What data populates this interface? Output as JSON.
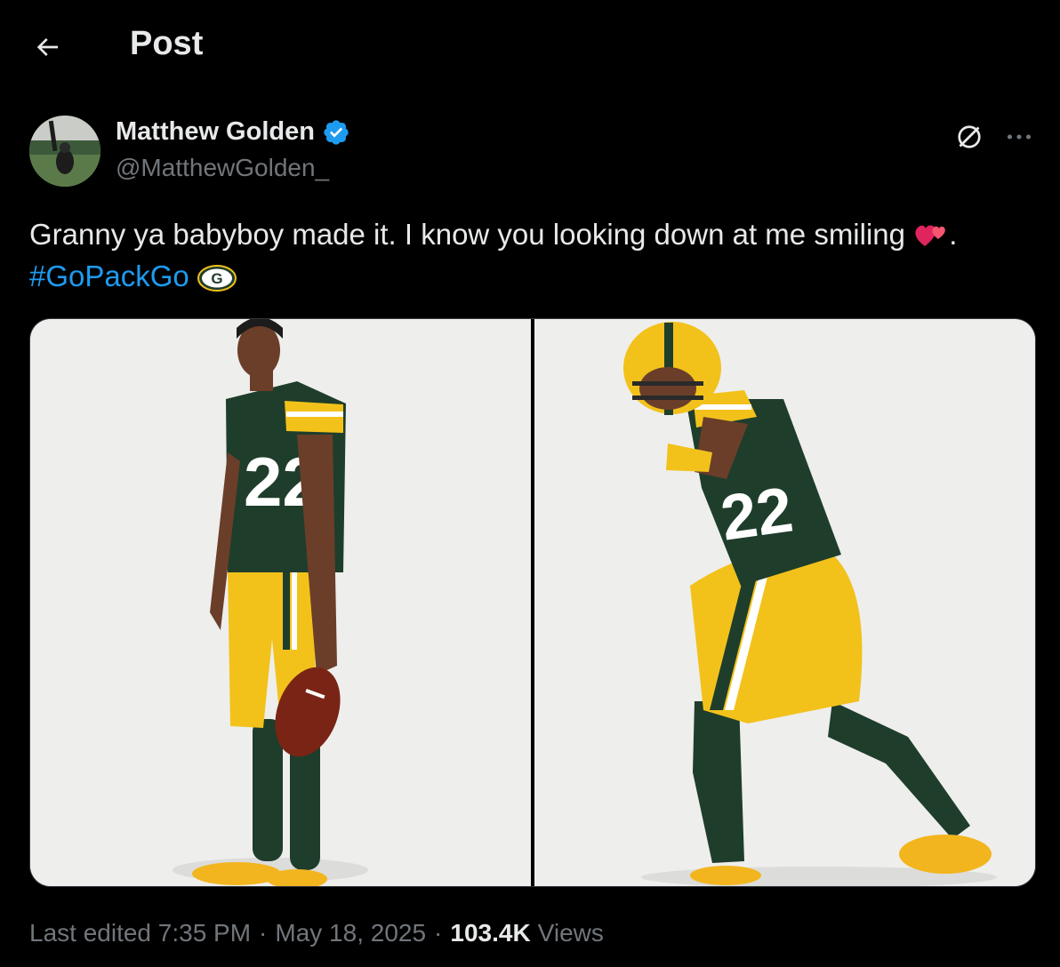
{
  "header": {
    "title": "Post"
  },
  "author": {
    "name": "Matthew Golden",
    "handle": "@MatthewGolden_"
  },
  "post": {
    "text": "Granny ya babyboy made it. I know you looking down at me smiling",
    "text_end": ".",
    "hashtag": "#GoPackGo",
    "hashtag_emoji": "G"
  },
  "media": {
    "photo_1_jersey_number": "22",
    "photo_2_jersey_number": "22"
  },
  "footer": {
    "last_edited": "Last edited 7:35 PM",
    "date": "May 18, 2025",
    "separator": "·",
    "views_count": "103.4K",
    "views_label": "Views"
  },
  "colors": {
    "accent": "#1d9bf0",
    "text_primary": "#e7e9ea",
    "text_secondary": "#71767b",
    "background": "#000000",
    "packers_green": "#1f3d2b",
    "packers_gold": "#f2c21b"
  },
  "icons": [
    "back-arrow-icon",
    "verified-badge-icon",
    "grok-icon",
    "more-icon",
    "two-hearts-emoji",
    "packers-logo-emoji"
  ]
}
